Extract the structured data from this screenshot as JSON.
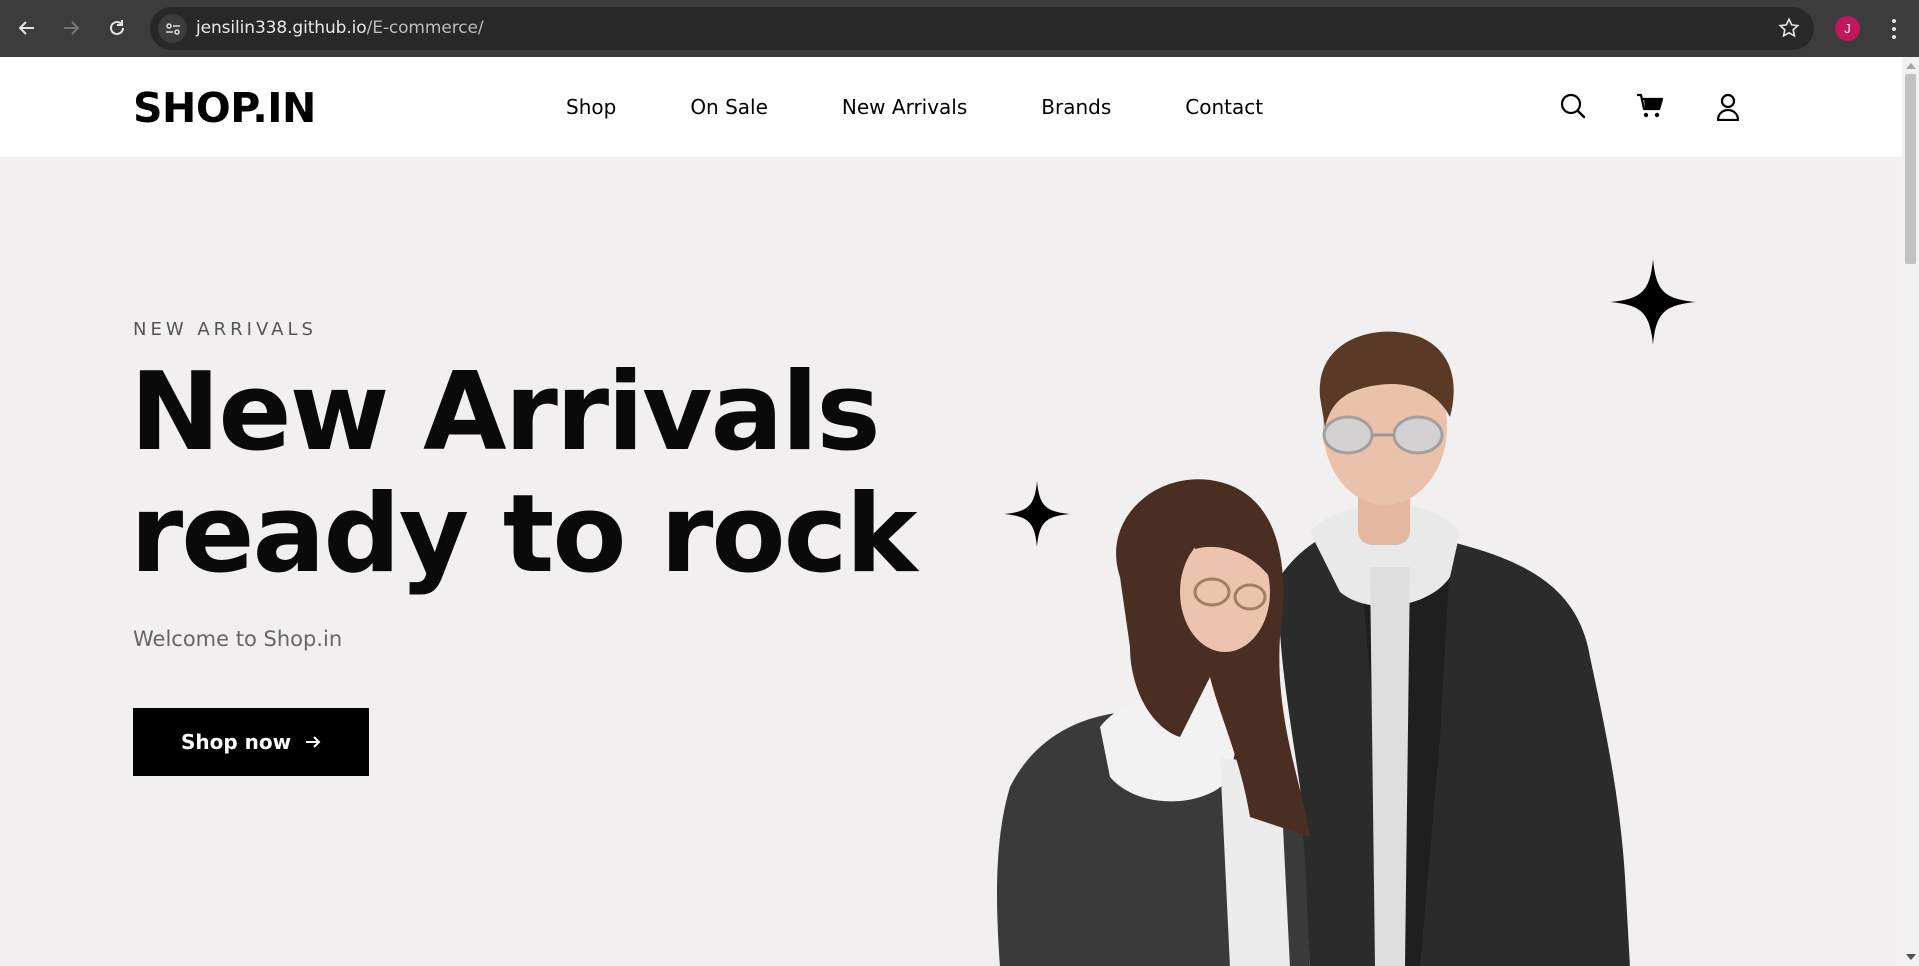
{
  "browser": {
    "url_host": "jensilin338.github.io",
    "url_path": "/E-commerce/",
    "profile_initial": "J"
  },
  "header": {
    "logo": "SHOP.IN",
    "nav": [
      "Shop",
      "On Sale",
      "New Arrivals",
      "Brands",
      "Contact"
    ],
    "icons": [
      "search-icon",
      "cart-icon",
      "user-icon"
    ]
  },
  "hero": {
    "eyebrow": "NEW ARRIVALS",
    "headline_line1": "New Arrivals",
    "headline_line2": "ready to rock",
    "subtitle": "Welcome to Shop.in",
    "cta_label": "Shop now",
    "cta_icon": "arrow-right-icon",
    "image_alt": "two models in denim jackets and white hoodies"
  },
  "colors": {
    "hero_bg": "#f1eff0",
    "chrome_bg": "#3c3c3c",
    "cta_bg": "#000000",
    "profile": "#c2185b"
  }
}
